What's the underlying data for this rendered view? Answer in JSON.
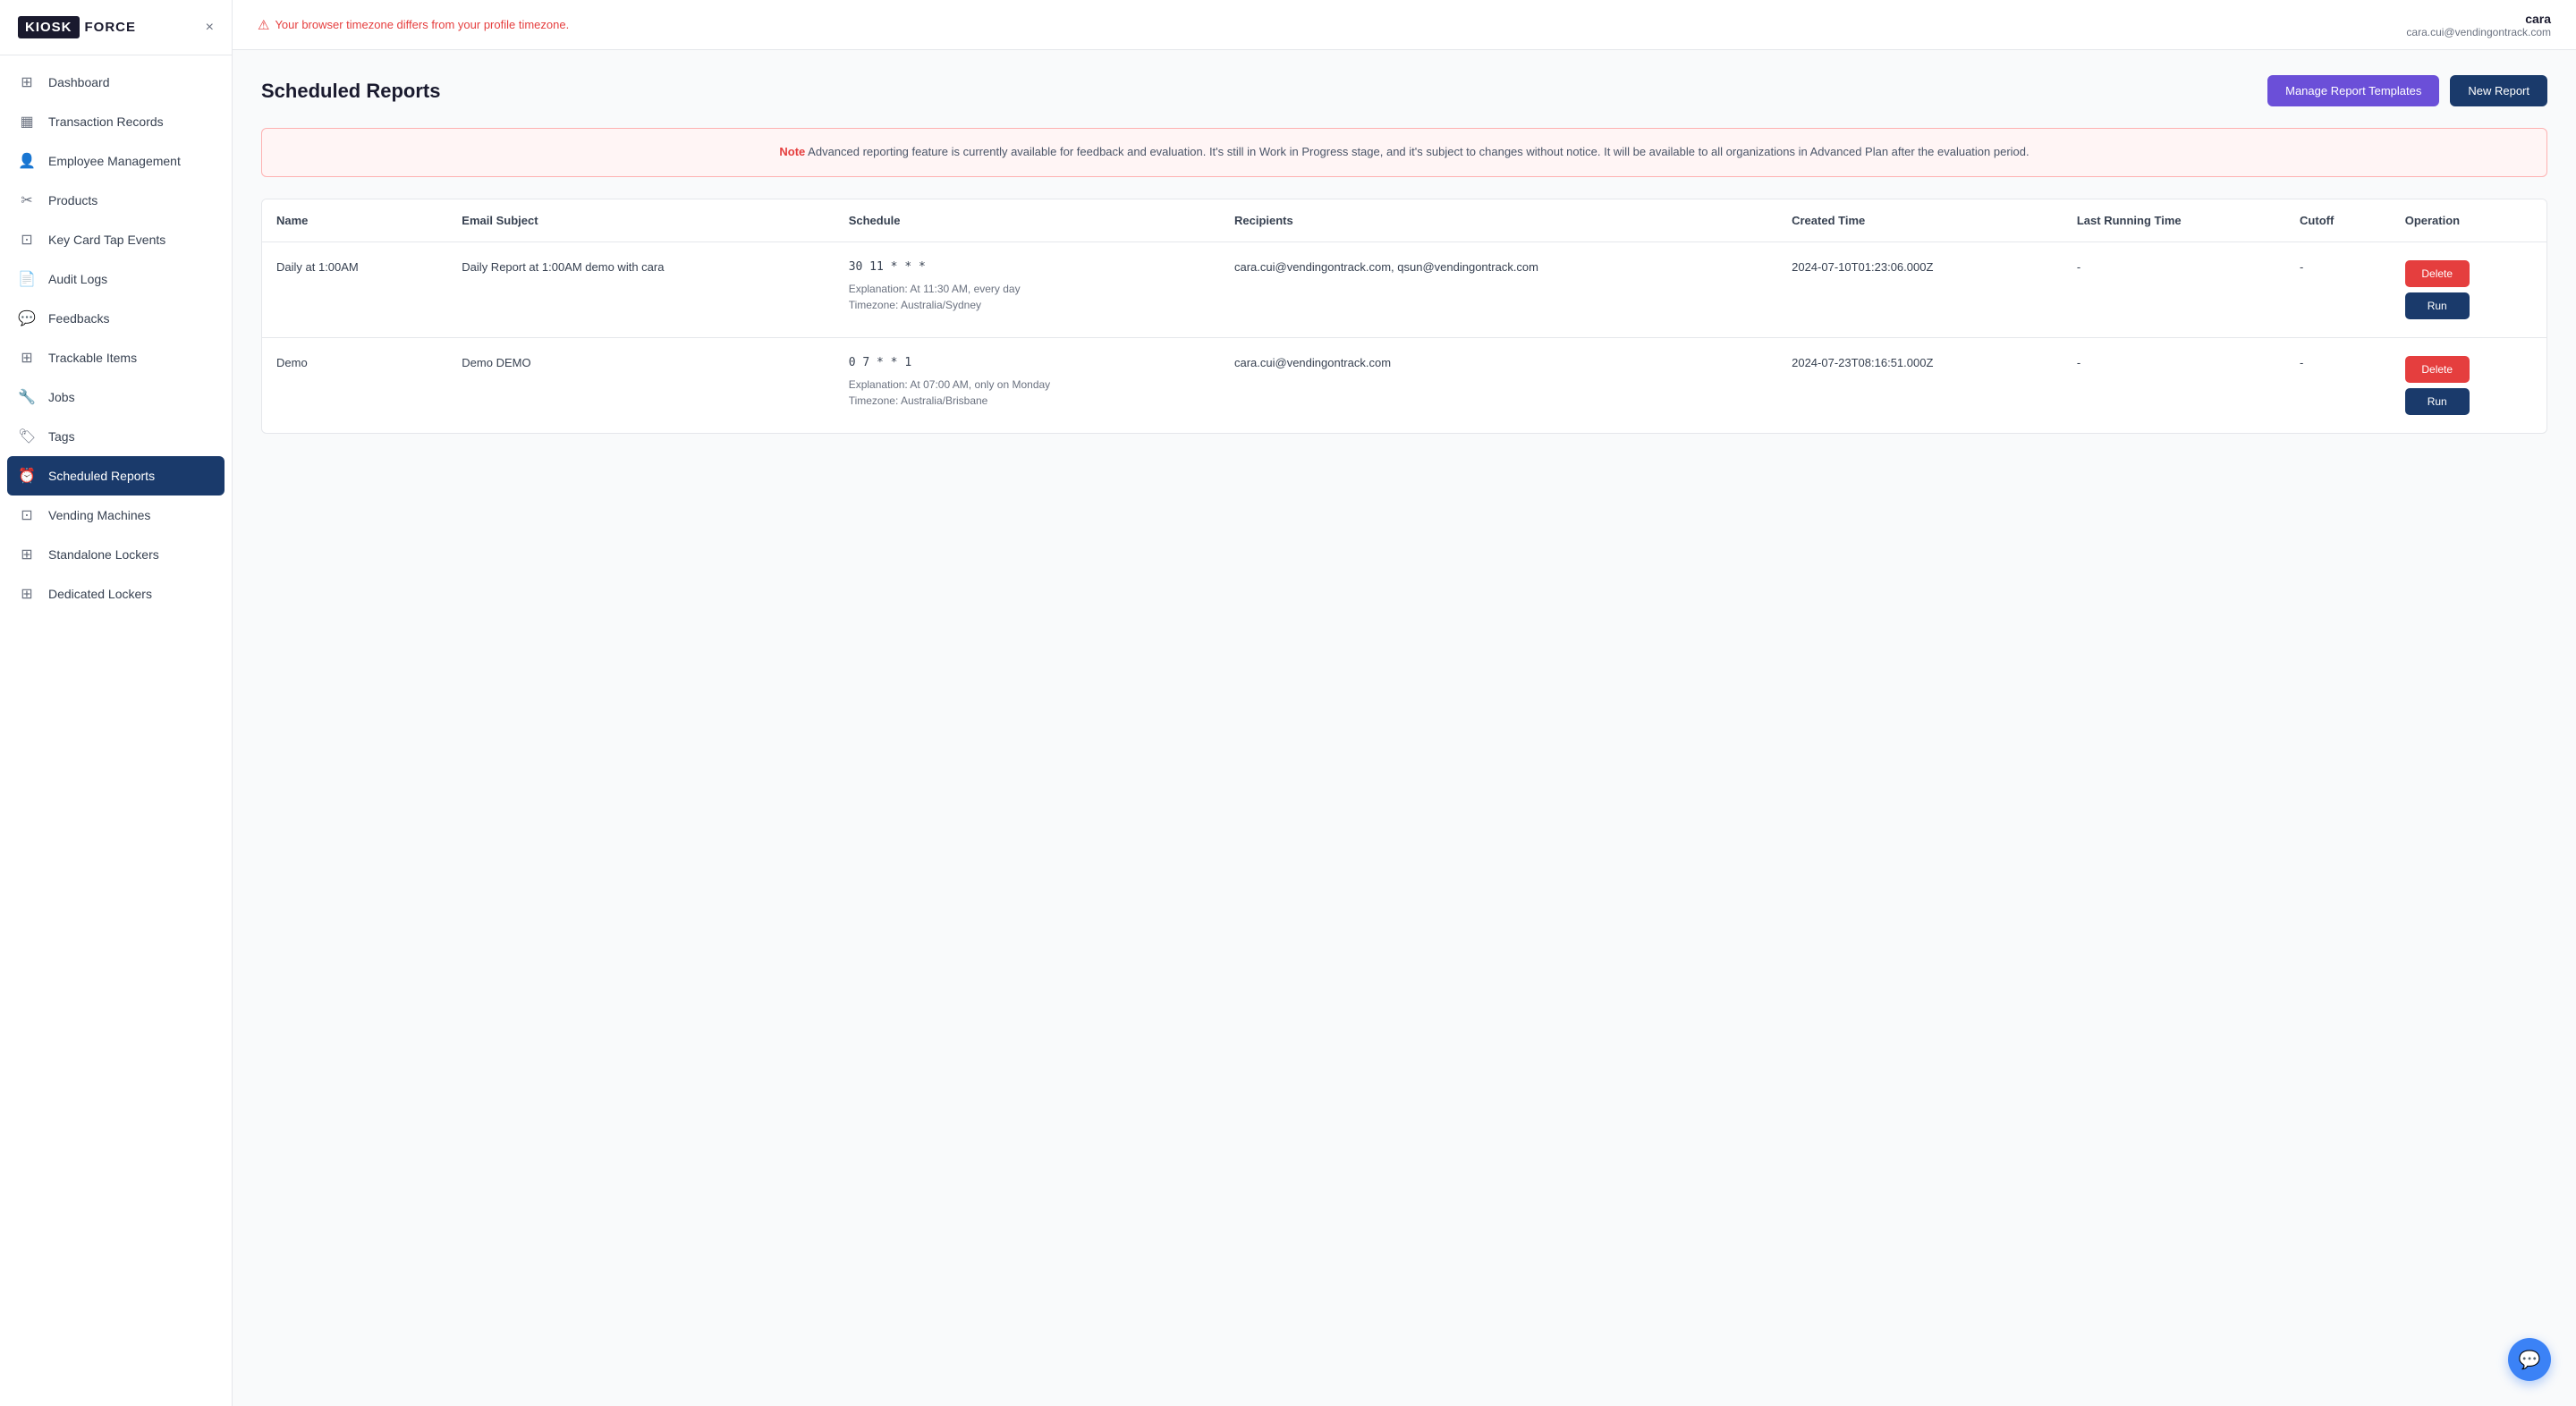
{
  "app": {
    "logo_kiosk": "KIOSK",
    "logo_force": "FORCE",
    "close_label": "×"
  },
  "topbar": {
    "timezone_warning": "Your browser timezone differs from your profile timezone.",
    "user_name": "cara",
    "user_email": "cara.cui@vendingontrack.com"
  },
  "sidebar": {
    "items": [
      {
        "id": "dashboard",
        "label": "Dashboard",
        "icon": "⊞"
      },
      {
        "id": "transaction-records",
        "label": "Transaction Records",
        "icon": "▦"
      },
      {
        "id": "employee-management",
        "label": "Employee Management",
        "icon": "👤"
      },
      {
        "id": "products",
        "label": "Products",
        "icon": "✂"
      },
      {
        "id": "key-card-tap-events",
        "label": "Key Card Tap Events",
        "icon": "⊡"
      },
      {
        "id": "audit-logs",
        "label": "Audit Logs",
        "icon": "📄"
      },
      {
        "id": "feedbacks",
        "label": "Feedbacks",
        "icon": "💬"
      },
      {
        "id": "trackable-items",
        "label": "Trackable Items",
        "icon": "⊞"
      },
      {
        "id": "jobs",
        "label": "Jobs",
        "icon": "🔧"
      },
      {
        "id": "tags",
        "label": "Tags",
        "icon": "🏷"
      },
      {
        "id": "scheduled-reports",
        "label": "Scheduled Reports",
        "icon": "⏰",
        "active": true
      },
      {
        "id": "vending-machines",
        "label": "Vending Machines",
        "icon": "⊡"
      },
      {
        "id": "standalone-lockers",
        "label": "Standalone Lockers",
        "icon": "⊞"
      },
      {
        "id": "dedicated-lockers",
        "label": "Dedicated Lockers",
        "icon": "⊞"
      }
    ]
  },
  "page": {
    "title": "Scheduled Reports",
    "manage_btn": "Manage Report Templates",
    "new_btn": "New Report",
    "note_bold": "Note",
    "note_text": "Advanced reporting feature is currently available for feedback and evaluation. It's still in Work in Progress stage, and it's subject to changes without notice. It will be available to all organizations in Advanced Plan after the evaluation period."
  },
  "table": {
    "headers": [
      "Name",
      "Email Subject",
      "Schedule",
      "Recipients",
      "Created Time",
      "Last Running Time",
      "Cutoff",
      "Operation"
    ],
    "rows": [
      {
        "name": "Daily at 1:00AM",
        "email_subject": "Daily Report at 1:00AM demo with cara",
        "schedule_code": "30 11 * * *",
        "schedule_explanation": "Explanation: At 11:30 AM, every day\nTimezone: Australia/Sydney",
        "recipients": "cara.cui@vendingontrack.com, qsun@vendingontrack.com",
        "created_time": "2024-07-10T01:23:06.000Z",
        "last_running": "-",
        "cutoff": "-"
      },
      {
        "name": "Demo",
        "email_subject": "Demo DEMO",
        "schedule_code": "0 7 * * 1",
        "schedule_explanation": "Explanation: At 07:00 AM, only on Monday\nTimezone: Australia/Brisbane",
        "recipients": "cara.cui@vendingontrack.com",
        "created_time": "2024-07-23T08:16:51.000Z",
        "last_running": "-",
        "cutoff": "-"
      }
    ],
    "delete_label": "Delete",
    "run_label": "Run"
  },
  "chat_icon": "💬"
}
